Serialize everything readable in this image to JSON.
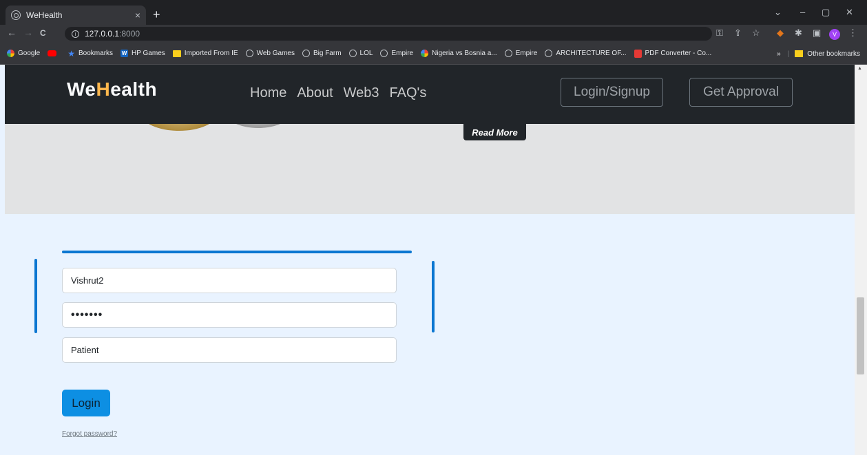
{
  "browser": {
    "tab_title": "WeHealth",
    "tab_close": "×",
    "new_tab": "+",
    "window_controls": [
      "⌄",
      "–",
      "▢",
      "✕"
    ],
    "nav_buttons": [
      "←",
      "→",
      "C"
    ],
    "url_host": "127.0.0.1",
    "url_port": ":8000",
    "toolbar_icons": [
      "key-icon",
      "share-icon",
      "star-icon",
      "fox-extension-icon",
      "puzzle-icon",
      "sidepanel-icon",
      "menu-icon"
    ],
    "profile_initial": "V",
    "bookmarks": [
      {
        "label": "Google",
        "icon": "g"
      },
      {
        "label": "",
        "icon": "yt"
      },
      {
        "label": "Bookmarks",
        "icon": "star"
      },
      {
        "label": "HP Games",
        "icon": "w"
      },
      {
        "label": "Imported From IE",
        "icon": "folder"
      },
      {
        "label": "Web Games",
        "icon": "globe"
      },
      {
        "label": "Big Farm",
        "icon": "globe"
      },
      {
        "label": "LOL",
        "icon": "globe"
      },
      {
        "label": "Empire",
        "icon": "globe"
      },
      {
        "label": "Nigeria vs Bosnia a...",
        "icon": "g"
      },
      {
        "label": "Empire",
        "icon": "globe"
      },
      {
        "label": "ARCHITECTURE OF...",
        "icon": "globe"
      },
      {
        "label": "PDF Converter - Co...",
        "icon": "pdf"
      }
    ],
    "bookmarks_overflow": "»",
    "other_bookmarks": "Other bookmarks"
  },
  "site": {
    "brand_we": "We",
    "brand_h": "H",
    "brand_rest": "ealth",
    "nav": [
      "Home",
      "About",
      "Web3",
      "FAQ's"
    ],
    "login_signup": "Login/Signup",
    "get_approval": "Get Approval",
    "read_more": "Read More"
  },
  "form": {
    "username_value": "Vishrut2",
    "password_value": "•••••••",
    "role_value": "Patient",
    "login_label": "Login",
    "forgot_label": "Forgot password?"
  },
  "colors": {
    "accent": "#0b76d1",
    "brand_highlight": "#ffb84d",
    "header_bg": "#212529",
    "page_bg": "#e9f3ff"
  }
}
